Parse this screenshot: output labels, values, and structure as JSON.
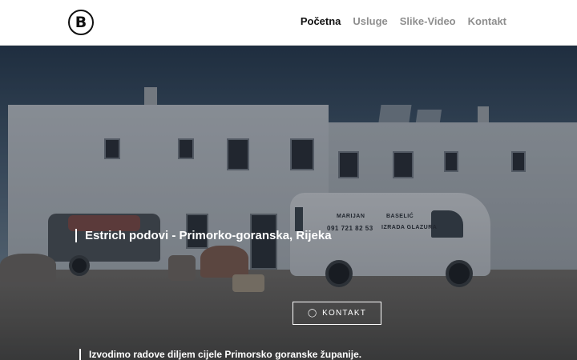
{
  "header": {
    "logo_letter": "B",
    "nav": [
      {
        "label": "Početna"
      },
      {
        "label": "Usluge"
      },
      {
        "label": "Slike-Video"
      },
      {
        "label": "Kontakt"
      }
    ]
  },
  "hero": {
    "title": "Estrich podovi - Primorko-goranska, Rijeka",
    "cta_label": "KONTAKT",
    "cta_icon": "chat-icon",
    "subtitle": "Izvodimo radove diljem cijele Primorsko goranske županije.",
    "van_text": {
      "name": "MARIJAN",
      "phone": "091 721 82 53",
      "brand": "BASELIĆ",
      "service": "IZRADA GLAZURA"
    }
  },
  "colors": {
    "nav_active": "#111111",
    "nav_inactive": "#8e8e8e",
    "hero_text": "#ffffff"
  }
}
